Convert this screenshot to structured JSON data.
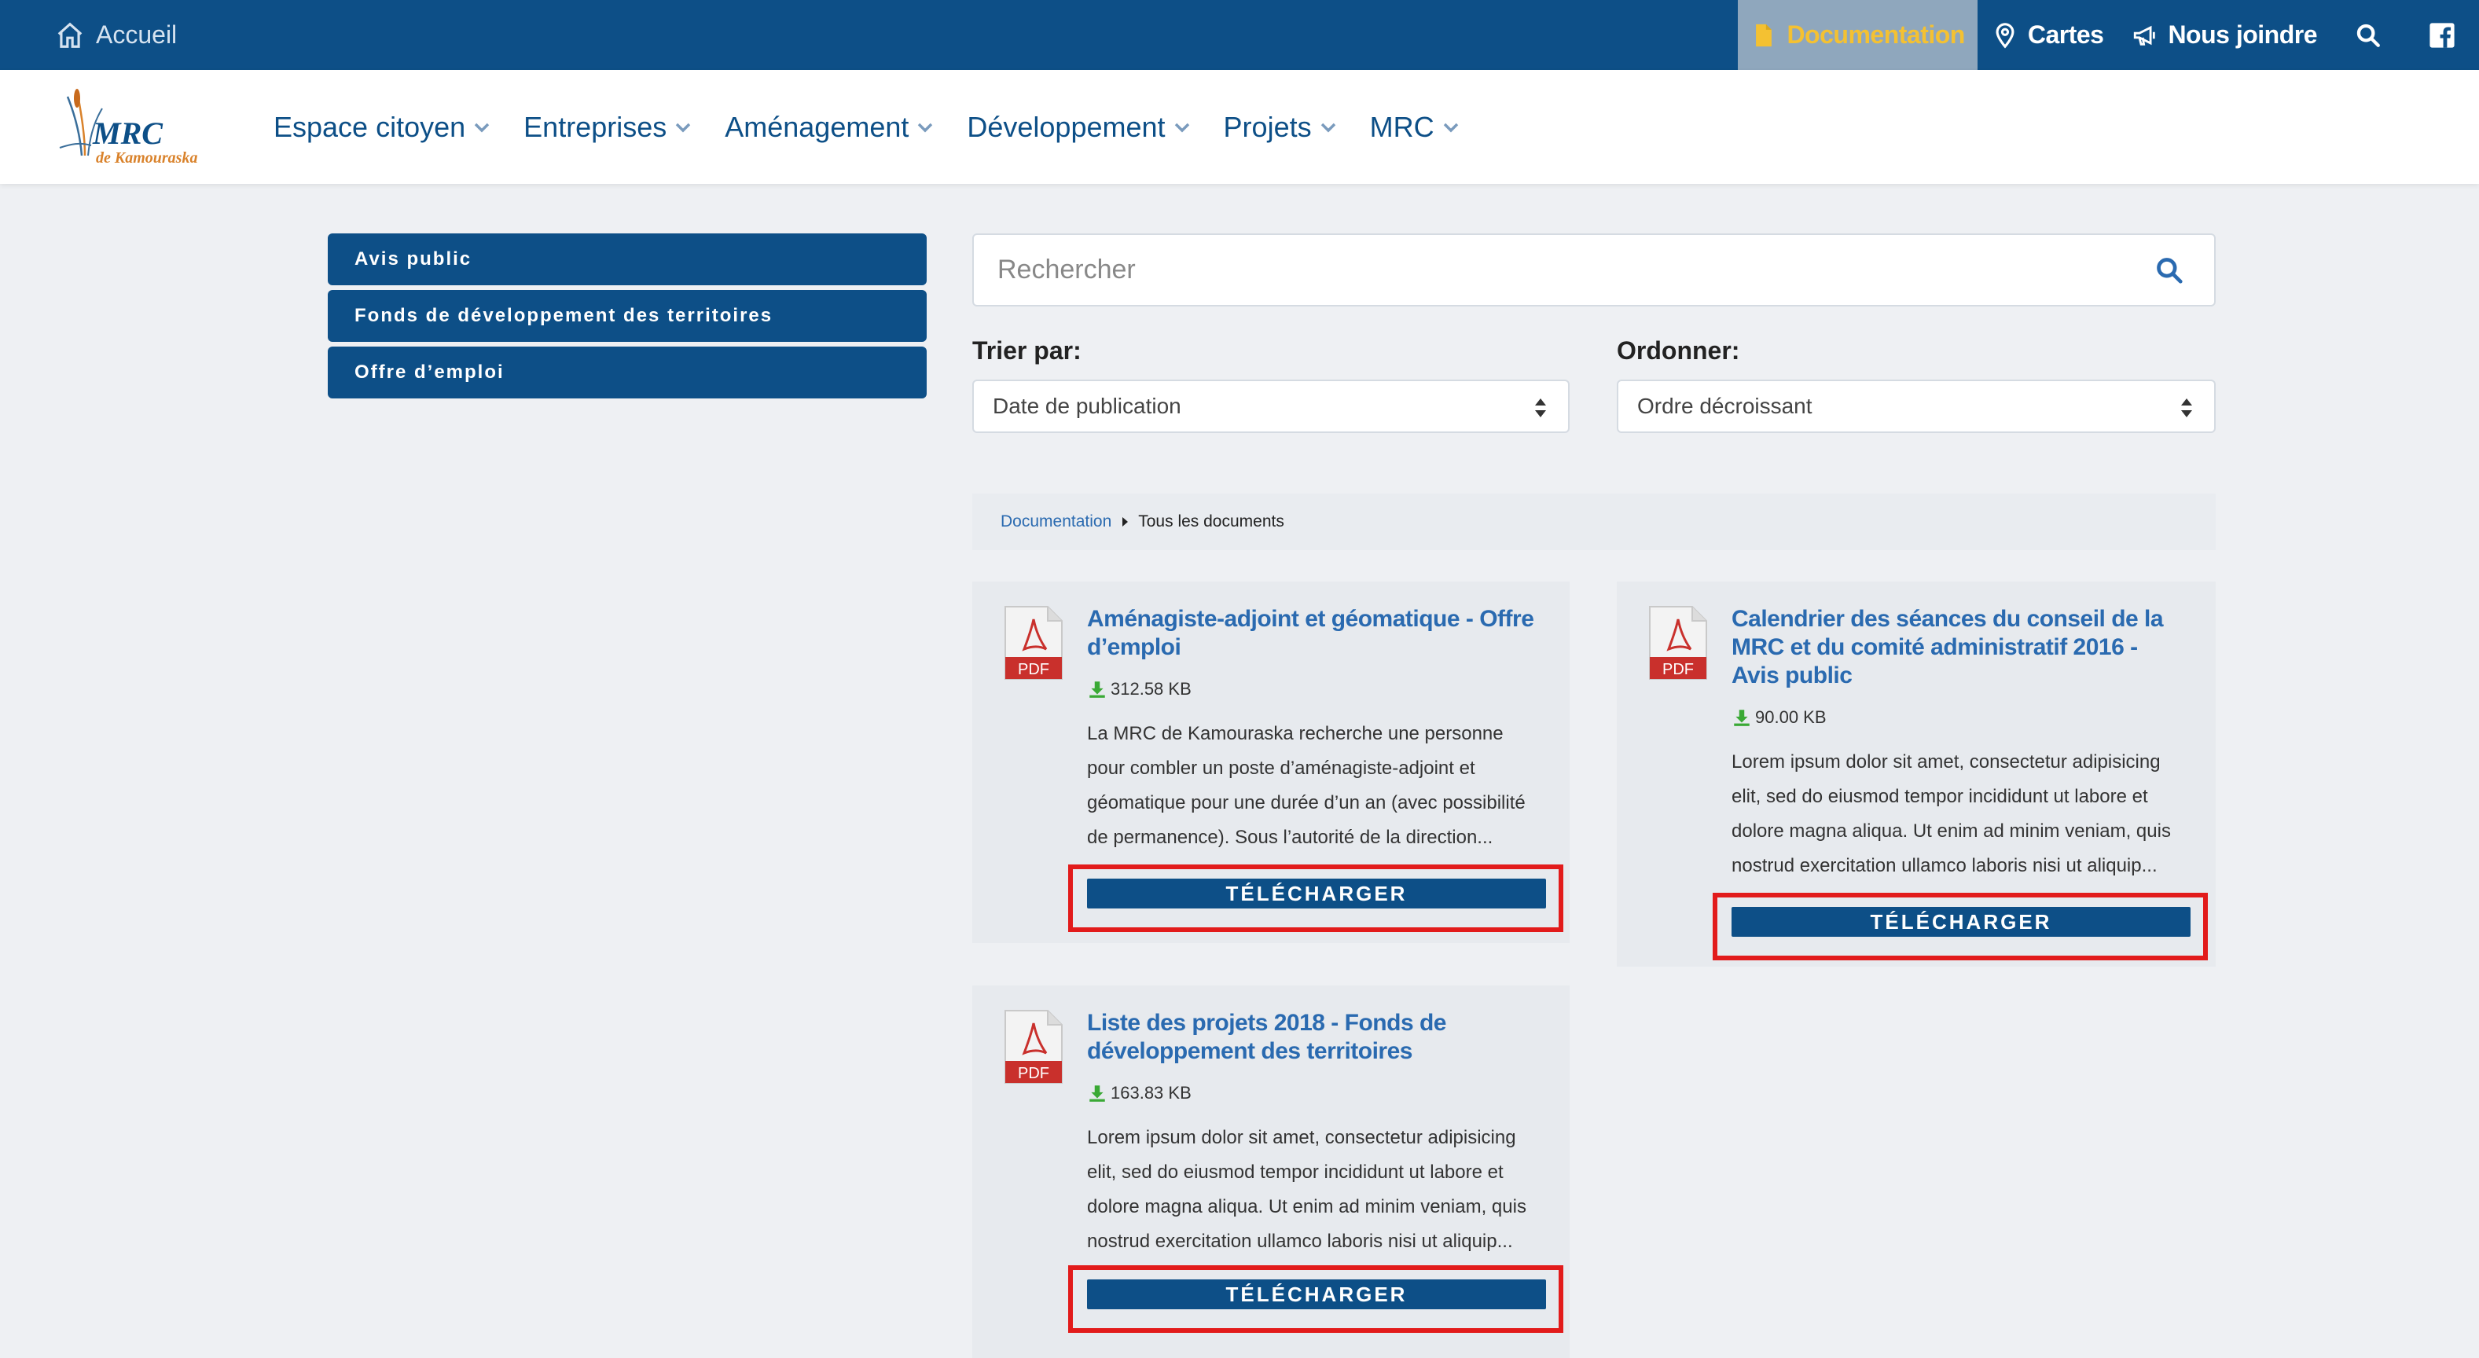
{
  "topbar": {
    "home": "Accueil",
    "documentation": "Documentation",
    "cartes": "Cartes",
    "nous_joindre": "Nous joindre"
  },
  "nav": {
    "logo_text": "MRC",
    "logo_subtext": "de Kamouraska",
    "items": [
      "Espace citoyen",
      "Entreprises",
      "Aménagement",
      "Développement",
      "Projets",
      "MRC"
    ]
  },
  "sidebar": {
    "items": [
      "Avis public",
      "Fonds de développement des territoires",
      "Offre d’emploi"
    ]
  },
  "search": {
    "placeholder": "Rechercher"
  },
  "filters": {
    "sort_label": "Trier par:",
    "sort_value": "Date de publication",
    "order_label": "Ordonner:",
    "order_value": "Ordre décroissant"
  },
  "breadcrumb": {
    "link": "Documentation",
    "current": "Tous les documents"
  },
  "documents": [
    {
      "icon": "PDF",
      "title": "Aménagiste-adjoint et géomatique - Offre d’emploi",
      "size": "312.58 KB",
      "description": "La MRC de Kamouraska recherche une personne pour combler un poste d’aménagiste-adjoint et géomatique pour une durée d’un an (avec possibilité de permanence). Sous l’autorité de la direction...",
      "button": "TÉLÉCHARGER"
    },
    {
      "icon": "PDF",
      "title": "Calendrier des séances du conseil de la MRC et du comité administratif 2016 - Avis public",
      "size": "90.00 KB",
      "description": "Lorem ipsum dolor sit amet, consectetur adipisicing elit, sed do eiusmod tempor incididunt ut labore et dolore magna aliqua. Ut enim ad minim veniam, quis nostrud exercitation ullamco laboris nisi ut aliquip...",
      "button": "TÉLÉCHARGER"
    },
    {
      "icon": "PDF",
      "title": "Liste des projets 2018 - Fonds de développement des territoires",
      "size": "163.83 KB",
      "description": "Lorem ipsum dolor sit amet, consectetur adipisicing elit, sed do eiusmod tempor incididunt ut labore et dolore magna aliqua. Ut enim ad minim veniam, quis nostrud exercitation ullamco laboris nisi ut aliquip...",
      "button": "TÉLÉCHARGER"
    }
  ],
  "colors": {
    "primary": "#0d4f87",
    "accent": "#f4c132",
    "link": "#2a6ab0",
    "highlight": "#e21b1b",
    "pdf": "#c9302c",
    "download": "#3aa935"
  }
}
